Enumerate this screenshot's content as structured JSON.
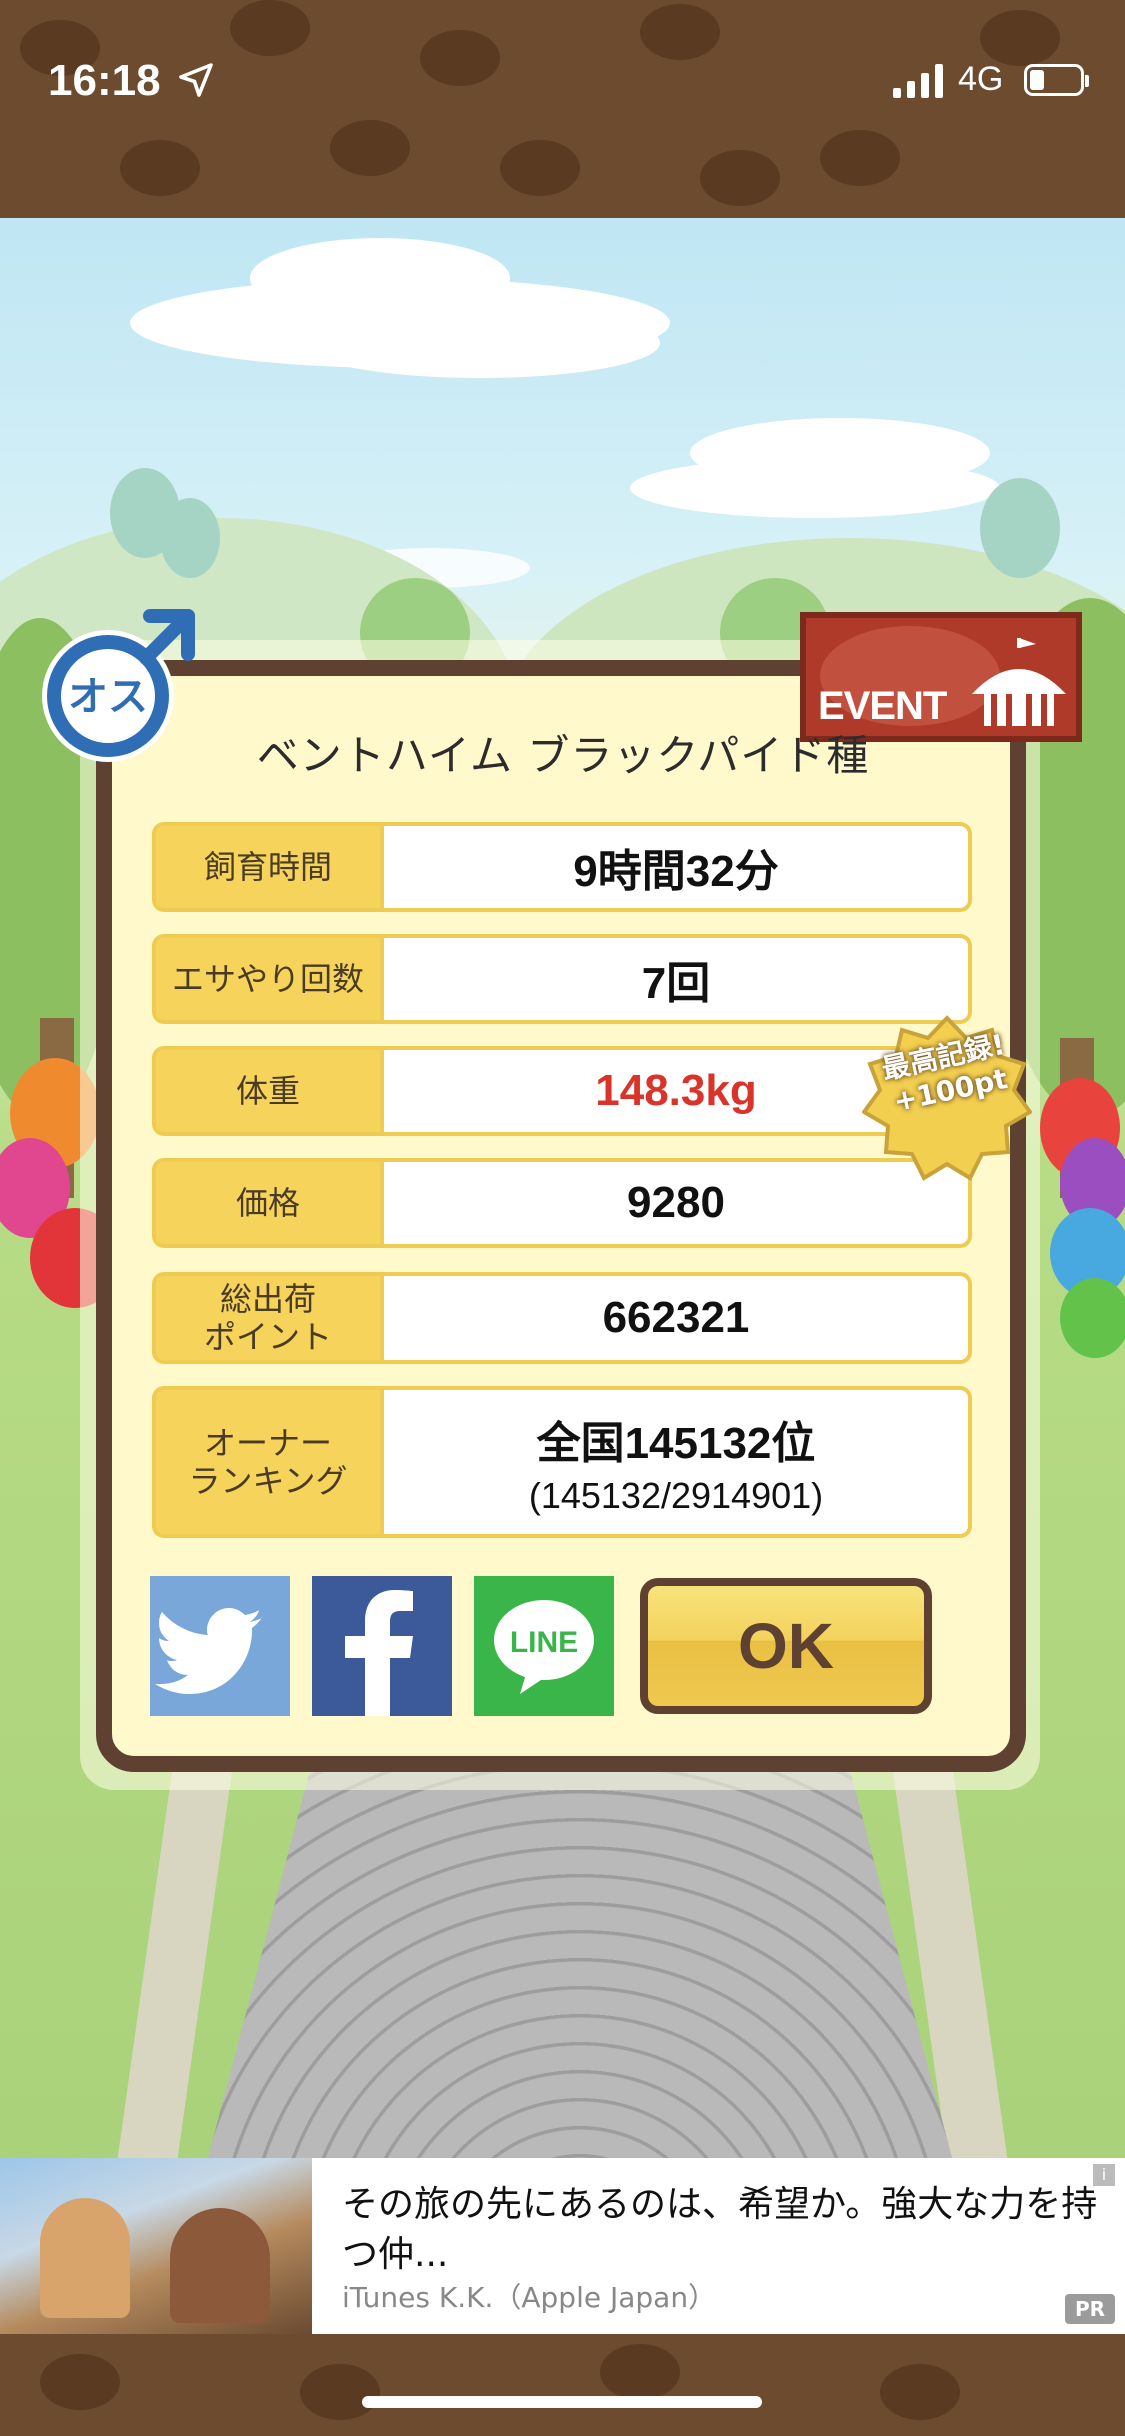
{
  "status_bar": {
    "time": "16:18",
    "network": "4G",
    "icons": [
      "location-arrow-icon",
      "signal-bars-icon",
      "battery-icon"
    ]
  },
  "badges": {
    "gender": "オス",
    "event": "EVENT",
    "record_line1": "最高記録!",
    "record_line2": "+100pt"
  },
  "panel": {
    "title": "ベントハイム ブラックパイド種",
    "stats": [
      {
        "label": "飼育時間",
        "value": "9時間32分"
      },
      {
        "label": "エサやり回数",
        "value": "7回"
      },
      {
        "label": "体重",
        "value": "148.3kg"
      },
      {
        "label": "価格",
        "value": "9280"
      },
      {
        "label": "総出荷\nポイント",
        "value": "662321"
      },
      {
        "label": "オーナー\nランキング",
        "value": "全国145132位",
        "sub": "(145132/2914901)"
      }
    ],
    "buttons": {
      "twitter": "twitter-share",
      "facebook": "facebook-share",
      "line": "LINE",
      "ok": "OK"
    }
  },
  "ad": {
    "text": "その旅の先にあるのは、希望か。強大な力を持つ仲...",
    "source": "iTunes K.K.（Apple Japan）",
    "pr": "PR",
    "info": "i"
  },
  "colors": {
    "brown": "#6d4b2e",
    "panel_border": "#5e4130",
    "label_yellow": "#f6d35b",
    "weight_red": "#d9332a",
    "twitter": "#79a7d9",
    "facebook": "#3c5a99",
    "line": "#39b54a"
  }
}
